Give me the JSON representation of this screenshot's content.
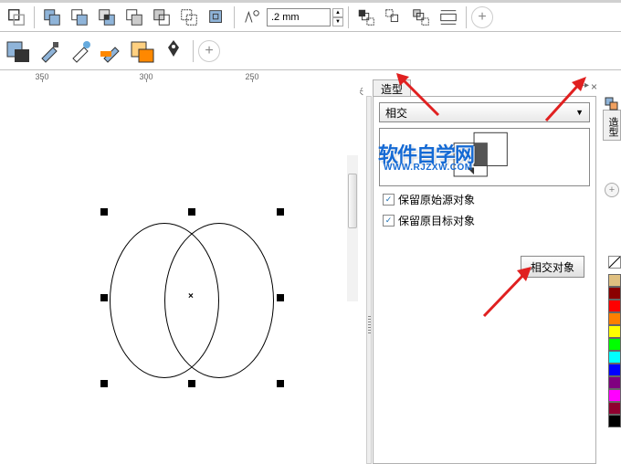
{
  "toolbar": {
    "stroke_width": ".2 mm",
    "pen_icon": "pen-nib"
  },
  "ruler": {
    "ticks": [
      350,
      300,
      250
    ],
    "unit_label": "毫米"
  },
  "panel": {
    "tab_label": "造型",
    "side_tab_label": "造型",
    "dropdown_selected": "相交",
    "checkbox1_label": "保留原始源对象",
    "checkbox2_label": "保留原目标对象",
    "action_button": "相交对象",
    "close_icons": "×"
  },
  "watermark": {
    "main_text": "软件自学网",
    "sub_text": "WWW.RJZXW.COM"
  },
  "colors": {
    "palette": [
      "#e0c080",
      "#8B0000",
      "#FF0000",
      "#FF7F00",
      "#FFFF00",
      "#00FF00",
      "#00FFFF",
      "#0000FF",
      "#800080",
      "#FF00FF",
      "#900030",
      "#000000"
    ]
  }
}
